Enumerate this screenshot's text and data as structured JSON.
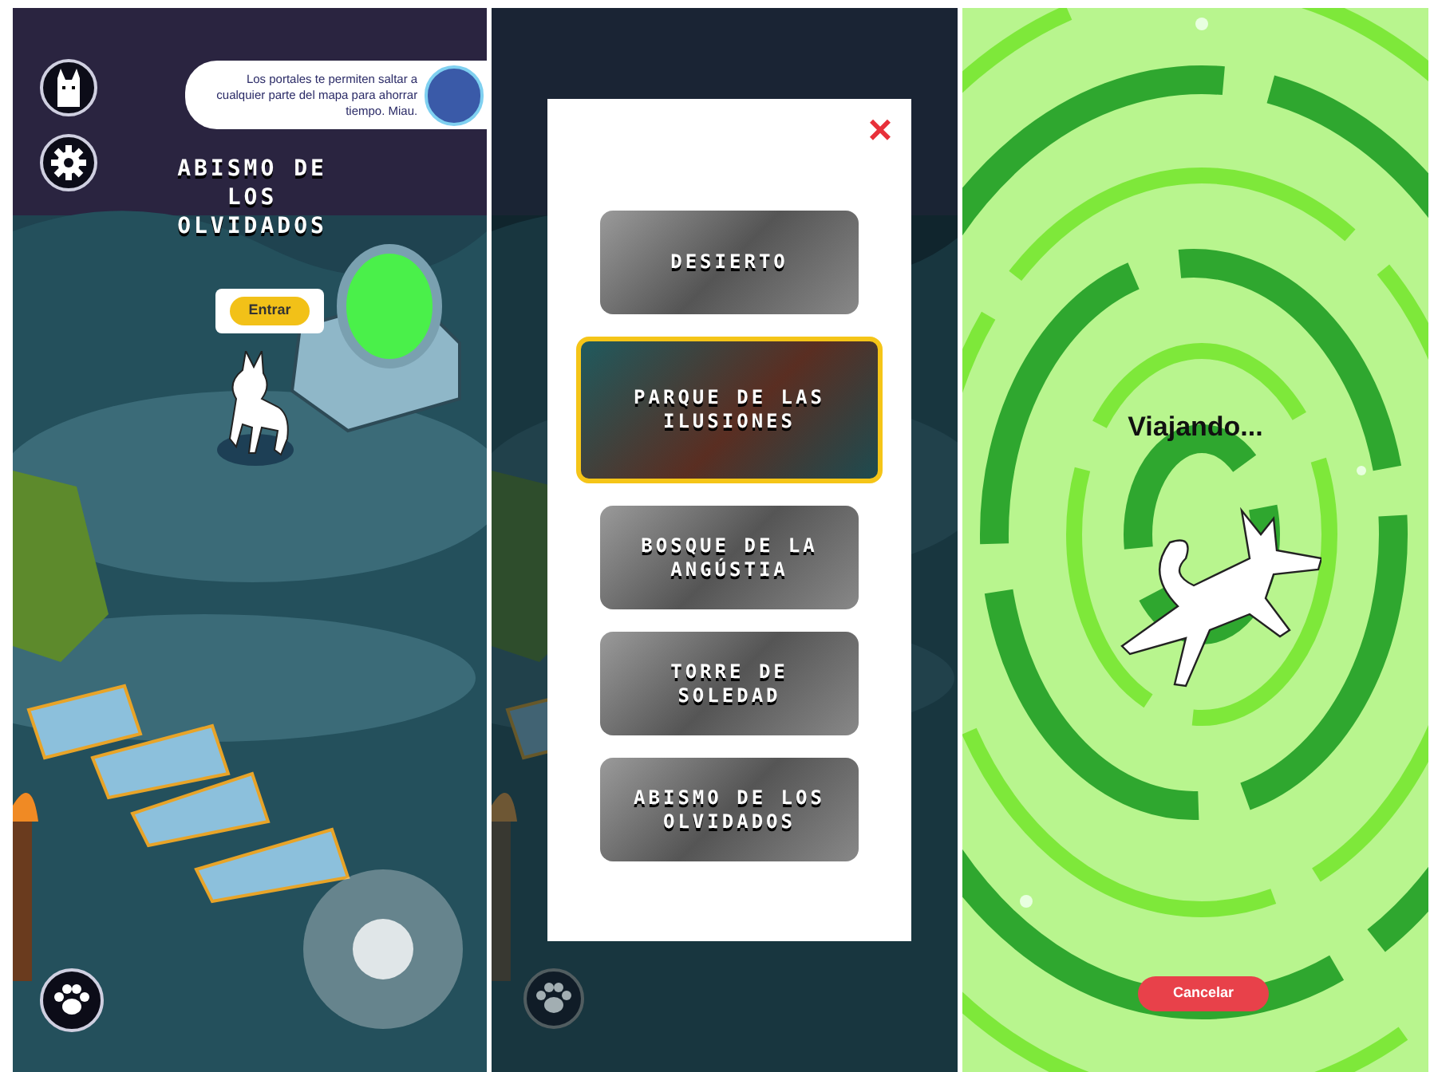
{
  "map_screen": {
    "hint": "Los portales te permiten saltar a cualquier parte del mapa para ahorrar tiempo. Miau.",
    "location_title": "ABISMO DE LOS OLVIDADOS",
    "enter_button": "Entrar"
  },
  "portal_menu": {
    "close": "×",
    "destinations": [
      {
        "name": "DESIERTO",
        "selected": false
      },
      {
        "name": "PARQUE DE LAS ILUSIONES",
        "selected": true
      },
      {
        "name": "BOSQUE DE LA ANGÚSTIA",
        "selected": false
      },
      {
        "name": "TORRE DE SOLEDAD",
        "selected": false
      },
      {
        "name": "ABISMO DE LOS OLVIDADOS",
        "selected": false
      }
    ]
  },
  "travel_screen": {
    "status": "Viajando...",
    "cancel_button": "Cancelar"
  }
}
